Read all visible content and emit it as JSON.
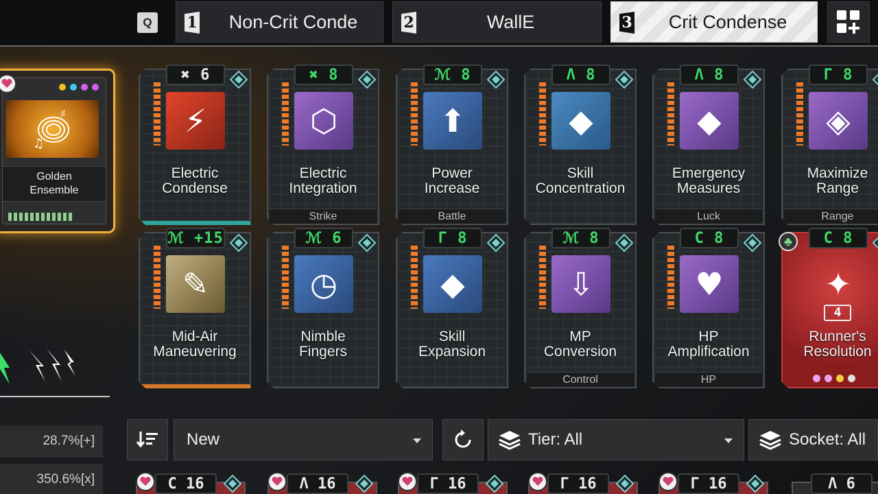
{
  "hotkey": "Q",
  "presets": [
    {
      "num": "1",
      "label": "Non-Crit Conde"
    },
    {
      "num": "2",
      "label": "WallE"
    },
    {
      "num": "3",
      "label": "Crit Condense"
    }
  ],
  "equipped": {
    "name": "Golden Ensemble"
  },
  "cards": [
    {
      "title": "Electric\nCondense",
      "capacity": "✖ 6",
      "sub": ""
    },
    {
      "title": "Electric\nIntegration",
      "capacity": "✖ 8",
      "sub": "Strike"
    },
    {
      "title": "Power\nIncrease",
      "capacity": "ℳ 8",
      "sub": "Battle"
    },
    {
      "title": "Skill\nConcentration",
      "capacity": "Λ 8",
      "sub": ""
    },
    {
      "title": "Emergency\nMeasures",
      "capacity": "Λ 8",
      "sub": "Luck"
    },
    {
      "title": "Maximize\nRange",
      "capacity": "Γ 8",
      "sub": "Range"
    },
    {
      "title": "Mid-Air\nManeuvering",
      "capacity": "ℳ +15",
      "sub": ""
    },
    {
      "title": "Nimble\nFingers",
      "capacity": "ℳ 6",
      "sub": ""
    },
    {
      "title": "Skill\nExpansion",
      "capacity": "Γ 8",
      "sub": ""
    },
    {
      "title": "MP\nConversion",
      "capacity": "ℳ 8",
      "sub": "Control"
    },
    {
      "title": "HP\nAmplification",
      "capacity": "C 8",
      "sub": "HP"
    },
    {
      "title": "Runner's\nResolution",
      "capacity": "C 8",
      "sub": "",
      "count": "4"
    }
  ],
  "stats": [
    "28.7%[+]",
    "350.6%[x]"
  ],
  "filters": {
    "sort": "New",
    "tier": "Tier: All",
    "socket": "Socket: All"
  },
  "bottom_caps": [
    "C 16",
    "Λ 16",
    "Γ 16",
    "Γ 16",
    "Γ 16",
    "Λ 6"
  ],
  "colors": {
    "accent_green": "#3ddc6a",
    "gold": "#f0b040",
    "tier_orange": "#f07a28"
  }
}
